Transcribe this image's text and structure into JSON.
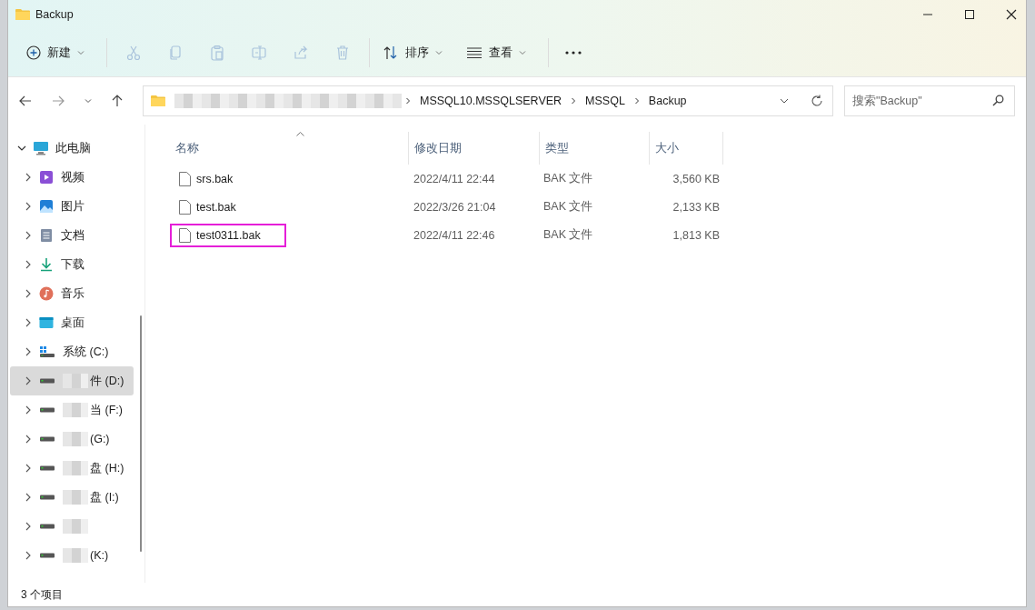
{
  "window": {
    "title": "Backup"
  },
  "toolbar": {
    "new_label": "新建",
    "sort_label": "排序",
    "view_label": "查看",
    "icon_buttons": [
      {
        "kind": "cut",
        "disabled": true
      },
      {
        "kind": "copy",
        "disabled": true
      },
      {
        "kind": "paste",
        "disabled": true
      },
      {
        "kind": "rename",
        "disabled": true
      },
      {
        "kind": "share",
        "disabled": true
      },
      {
        "kind": "delete",
        "disabled": true
      }
    ]
  },
  "address": {
    "segments": [
      "MSSQL10.MSSQLSERVER",
      "MSSQL",
      "Backup"
    ]
  },
  "search": {
    "placeholder": "搜索\"Backup\""
  },
  "sidebar": {
    "root": {
      "label": "此电脑",
      "expanded": true,
      "children": [
        {
          "kind": "video",
          "label": "视频",
          "selected": false,
          "blurred": false
        },
        {
          "kind": "pictures",
          "label": "图片",
          "selected": false,
          "blurred": false
        },
        {
          "kind": "documents",
          "label": "文档",
          "selected": false,
          "blurred": false
        },
        {
          "kind": "downloads",
          "label": "下载",
          "selected": false,
          "blurred": false
        },
        {
          "kind": "music",
          "label": "音乐",
          "selected": false,
          "blurred": false
        },
        {
          "kind": "desktop",
          "label": "桌面",
          "selected": false,
          "blurred": false
        },
        {
          "kind": "system-drive",
          "label": "系统 (C:)",
          "selected": false,
          "blurred": false
        },
        {
          "kind": "drive",
          "label": "件 (D:)",
          "selected": true,
          "blurred": true
        },
        {
          "kind": "drive",
          "label": "当 (F:)",
          "selected": false,
          "blurred": true
        },
        {
          "kind": "drive",
          "label": "(G:)",
          "selected": false,
          "blurred": true
        },
        {
          "kind": "drive",
          "label": "盘 (H:)",
          "selected": false,
          "blurred": true
        },
        {
          "kind": "drive",
          "label": "盘 (I:)",
          "selected": false,
          "blurred": true
        },
        {
          "kind": "drive",
          "selected": false,
          "blurred": true
        },
        {
          "kind": "drive",
          "label": "(K:)",
          "selected": false,
          "blurred": true
        }
      ]
    }
  },
  "table": {
    "columns": [
      {
        "label": "名称",
        "sorted": true
      },
      {
        "label": "修改日期",
        "sorted": false
      },
      {
        "label": "类型",
        "sorted": false
      },
      {
        "label": "大小",
        "sorted": false
      }
    ],
    "rows": [
      {
        "name": "srs.bak",
        "modified": "2022/4/11 22:44",
        "type": "BAK 文件",
        "size": "3,560 KB",
        "highlighted": false
      },
      {
        "name": "test.bak",
        "modified": "2022/3/26 21:04",
        "type": "BAK 文件",
        "size": "2,133 KB",
        "highlighted": false
      },
      {
        "name": "test0311.bak",
        "modified": "2022/4/11 22:46",
        "type": "BAK 文件",
        "size": "1,813 KB",
        "highlighted": true
      }
    ]
  },
  "status_bar": {
    "item_count": "3 个项目"
  }
}
